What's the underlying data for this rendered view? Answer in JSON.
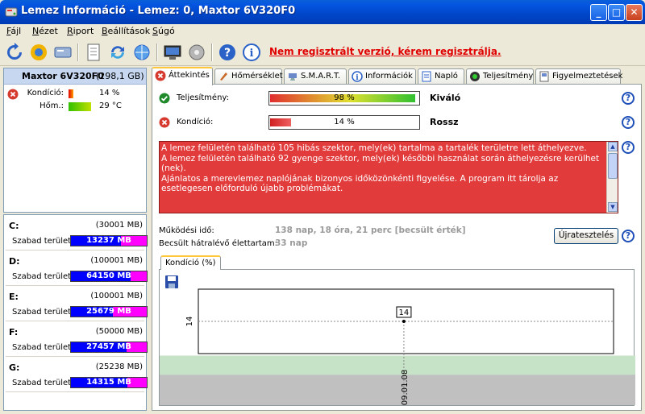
{
  "window": {
    "title": "Lemez Információ - Lemez: 0, Maxtor 6V320F0"
  },
  "menu": [
    {
      "label": "Fájl",
      "ul": "F",
      "rest": "ájl"
    },
    {
      "label": "Nézet",
      "ul": "N",
      "rest": "ézet"
    },
    {
      "label": "Riport",
      "ul": "R",
      "rest": "iport"
    },
    {
      "label": "Beállítások",
      "ul": "B",
      "rest": "eállítások"
    },
    {
      "label": "Súgó",
      "ul": "S",
      "rest": "úgó"
    }
  ],
  "toolbar": {
    "registration_link": "Nem regisztrált verzió, kérem regisztrálja."
  },
  "disk": {
    "name": "Maxtor 6V320F0",
    "size": "(298,1 GB)",
    "condition_label": "Kondíció:",
    "condition_value": "14 %",
    "condition_fraction": 0.14,
    "temp_label": "Hőm.:",
    "temp_value": "29 °C",
    "temp_fraction": 0.7
  },
  "partitions": [
    {
      "letter": "C:",
      "size": "(30001 MB)",
      "free_label": "Szabad terület",
      "free": "13237 MB",
      "free_fraction": 0.44
    },
    {
      "letter": "D:",
      "size": "(100001 MB)",
      "free_label": "Szabad terület",
      "free": "64150 MB",
      "free_fraction": 0.64
    },
    {
      "letter": "E:",
      "size": "(100001 MB)",
      "free_label": "Szabad terület",
      "free": "25679 MB",
      "free_fraction": 0.26
    },
    {
      "letter": "F:",
      "size": "(50000 MB)",
      "free_label": "Szabad terület",
      "free": "27457 MB",
      "free_fraction": 0.55
    },
    {
      "letter": "G:",
      "size": "(25238 MB)",
      "free_label": "Szabad terület",
      "free": "14315 MB",
      "free_fraction": 0.57
    }
  ],
  "tabs": [
    {
      "label": "Áttekintés",
      "icon": "error-icon"
    },
    {
      "label": "Hőmérséklet",
      "icon": "thermometer-icon"
    },
    {
      "label": "S.M.A.R.T.",
      "icon": "smart-icon"
    },
    {
      "label": "Információk",
      "icon": "info-icon"
    },
    {
      "label": "Napló",
      "icon": "log-icon"
    },
    {
      "label": "Teljesítmény",
      "icon": "performance-icon"
    },
    {
      "label": "Figyelmeztetések",
      "icon": "warnings-icon"
    }
  ],
  "overview": {
    "performance_label": "Teljesítmény:",
    "performance_value": "98 %",
    "performance_fraction": 0.98,
    "performance_word": "Kiváló",
    "condition_label": "Kondíció:",
    "condition_value": "14 %",
    "condition_fraction": 0.14,
    "condition_word": "Rossz",
    "alert_text": "A lemez felületén található 105 hibás szektor, mely(ek) tartalma a tartalék területre lett áthelyezve.\nA lemez felületén található 92 gyenge szektor, mely(ek) későbbi használat során áthelyezésre kerülhet (nek).\nAjánlatos a merevlemez naplójának bizonyos időközönkénti figyelése. A program itt tárolja az esetlegesen előforduló újabb problémákat.",
    "uptime_label": "Működési idő:",
    "uptime_value": "138 nap, 18 óra, 21 perc [becsült érték]",
    "life_label": "Becsült hátralévő élettartam:",
    "life_value": "33 nap",
    "restart_button": "Újratesztelés",
    "chart_tab": "Kondíció (%)"
  },
  "chart_data": {
    "type": "line",
    "x": [
      "09.01.08"
    ],
    "series": [
      {
        "values": [
          14
        ]
      }
    ],
    "ylim": [
      0,
      30
    ],
    "data_labels": [
      "14"
    ],
    "y_ticks": [
      "14"
    ],
    "x_ticks": [
      "09.01.08"
    ],
    "bands": [
      {
        "from": 0,
        "to": 8,
        "color": "#c0c0c0"
      },
      {
        "from": 8,
        "to": 13,
        "color": "#c7e3c7"
      }
    ],
    "grid": false
  }
}
